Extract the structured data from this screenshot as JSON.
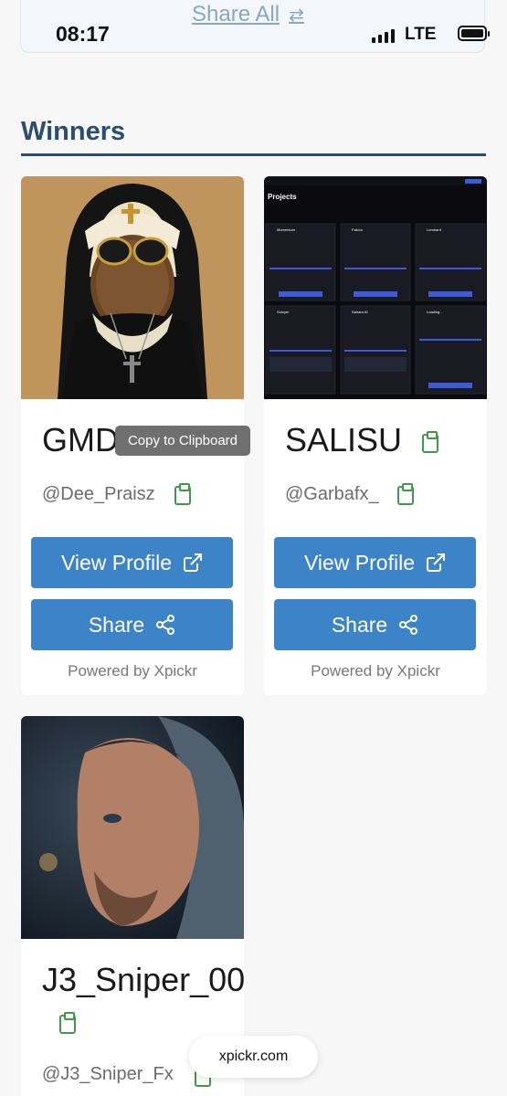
{
  "status_bar": {
    "time": "08:17",
    "network": "LTE"
  },
  "top_link": {
    "label": "Share All"
  },
  "section": {
    "title": "Winners"
  },
  "cards": [
    {
      "name": "GMD",
      "handle": "@Dee_Praisz",
      "view_label": "View Profile",
      "share_label": "Share",
      "powered": "Powered by Xpickr"
    },
    {
      "name": "SALISU",
      "handle": "@Garbafx_",
      "view_label": "View Profile",
      "share_label": "Share",
      "powered": "Powered by Xpickr"
    },
    {
      "name": "J3_Sniper_00",
      "handle": "@J3_Sniper_Fx"
    }
  ],
  "dashboard": {
    "heading": "Projects",
    "projects": [
      "Momentum",
      "Falcon",
      "Lombard",
      "Soloyer",
      "Sahara AI",
      "Loading..."
    ]
  },
  "tooltip": {
    "text": "Copy to Clipboard"
  },
  "url_bar": {
    "text": "xpickr.com"
  },
  "colors": {
    "primary": "#3c83c8",
    "heading": "#2a4d70",
    "clipboard": "#3f9a45"
  }
}
